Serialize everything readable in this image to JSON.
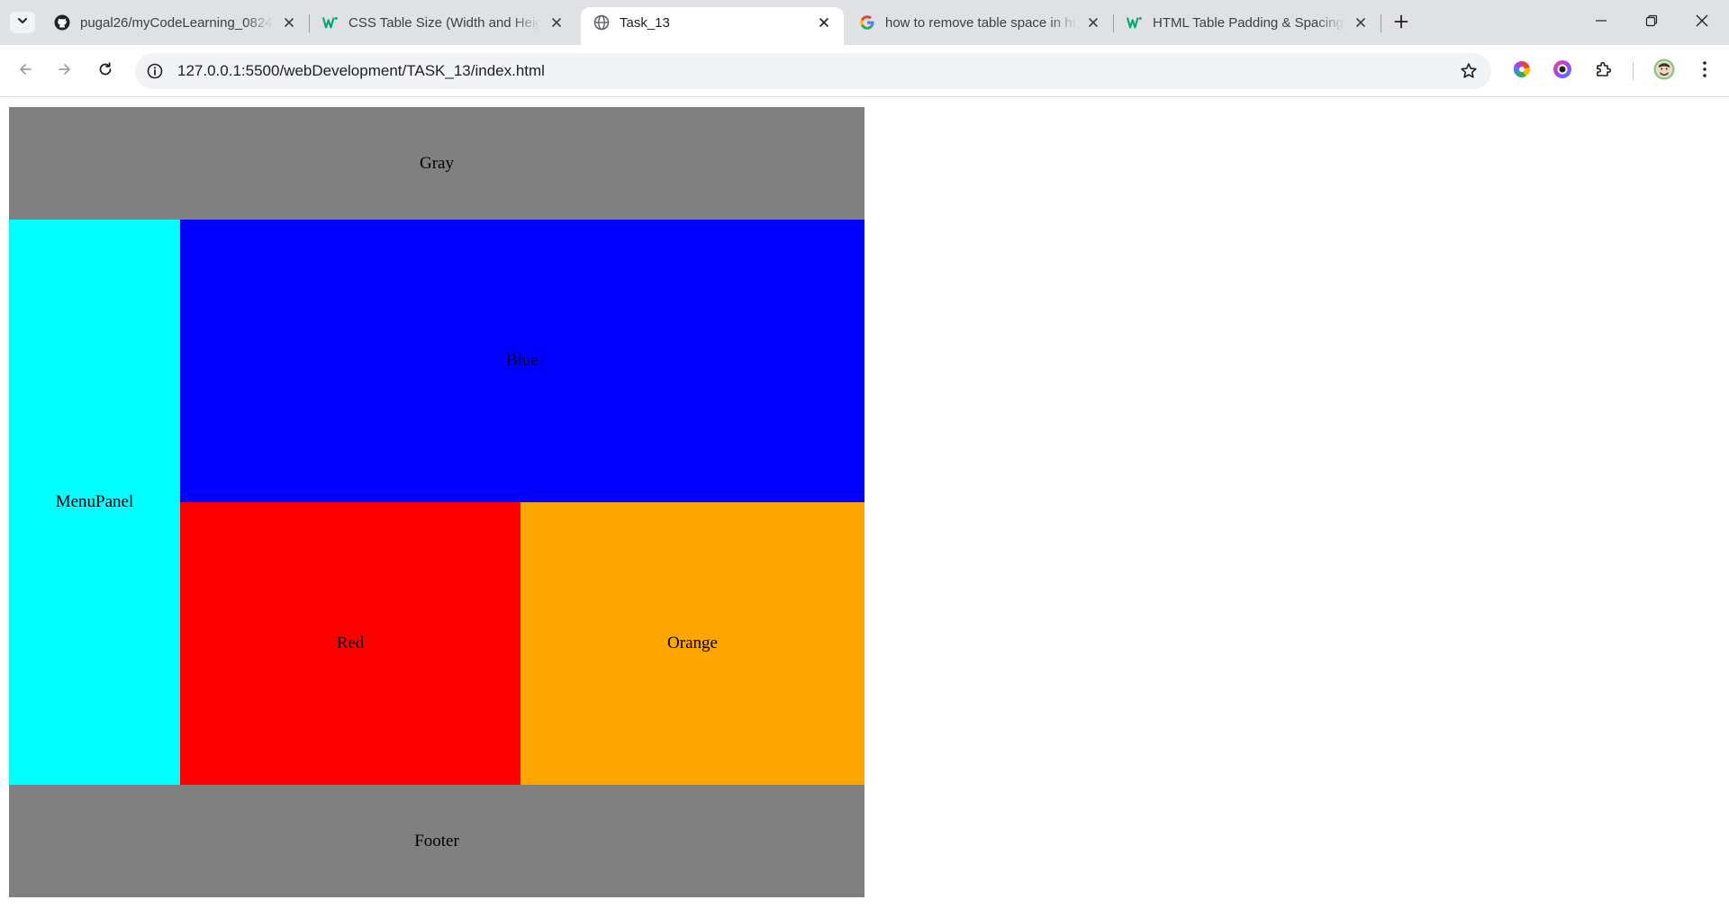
{
  "browser": {
    "tabs": [
      {
        "title": "pugal26/myCodeLearning_0824",
        "favicon": "github-icon",
        "active": false
      },
      {
        "title": "CSS Table Size (Width and Height)",
        "favicon": "w3schools-icon",
        "active": false
      },
      {
        "title": "Task_13",
        "favicon": "globe-icon",
        "active": true
      },
      {
        "title": "how to remove table space in html",
        "favicon": "google-icon",
        "active": false
      },
      {
        "title": "HTML Table Padding & Spacing",
        "favicon": "w3schools-icon",
        "active": false
      }
    ],
    "address": {
      "url": "127.0.0.1:5500/webDevelopment/TASK_13/index.html"
    },
    "icons": {
      "tab_search": "chevron-down-icon",
      "new_tab": "plus-icon",
      "back": "arrow-left-icon",
      "forward": "arrow-right-icon",
      "reload": "reload-icon",
      "site_info": "info-icon",
      "bookmark": "star-icon",
      "extension_1": "color-wheel-icon",
      "extension_2": "screen-recorder-icon",
      "extensions": "puzzle-icon",
      "profile": "avatar-icon",
      "menu": "kebab-menu-icon"
    }
  },
  "page": {
    "cells": {
      "header": {
        "label": "Gray",
        "color": "#808080"
      },
      "menu": {
        "label": "MenuPanel",
        "color": "#00ffff"
      },
      "blue": {
        "label": "Blue",
        "color": "#0000ff"
      },
      "red": {
        "label": "Red",
        "color": "#ff0000"
      },
      "orange": {
        "label": "Orange",
        "color": "#ffa500"
      },
      "footer": {
        "label": "Footer",
        "color": "#808080"
      }
    }
  }
}
